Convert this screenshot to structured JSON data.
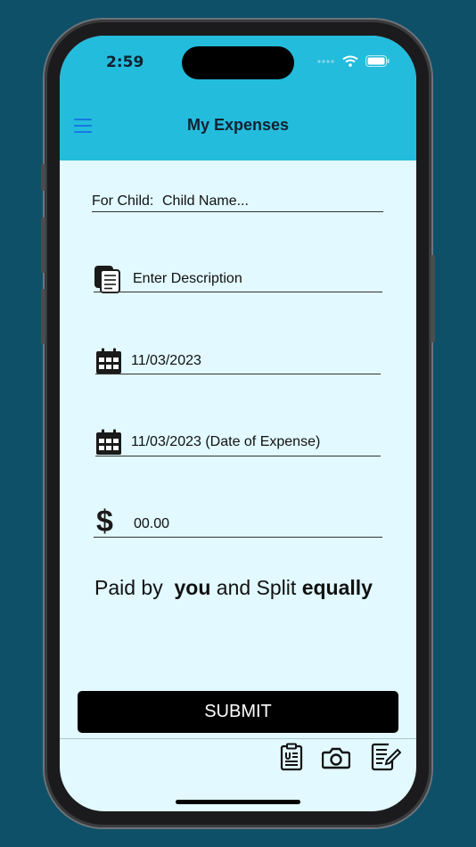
{
  "status_bar": {
    "time": "2:59"
  },
  "header": {
    "title": "My Expenses"
  },
  "form": {
    "child_field": {
      "label": "For Child:",
      "placeholder": "Child Name..."
    },
    "description_field": {
      "placeholder": "Enter Description"
    },
    "date_field": {
      "value": "11/03/2023"
    },
    "expense_date_field": {
      "value": "11/03/2023 (Date of Expense)"
    },
    "amount_field": {
      "currency_symbol": "$",
      "value": "00.00"
    },
    "split": {
      "prefix": "Paid by",
      "payer": "you",
      "middle": "and Split",
      "method": "equally"
    },
    "submit_label": "SUBMIT"
  },
  "icons": {
    "menu": "hamburger-menu-icon",
    "description": "notes-icon",
    "date": "calendar-icon",
    "camera": "camera-icon",
    "receipt": "clipboard-icon",
    "edit": "edit-note-icon"
  },
  "colors": {
    "header_bg": "#24bcdc",
    "screen_bg": "#e1f9ff",
    "menu_icon": "#1479e0",
    "button_bg": "#000000",
    "page_bg": "#0f5069"
  }
}
